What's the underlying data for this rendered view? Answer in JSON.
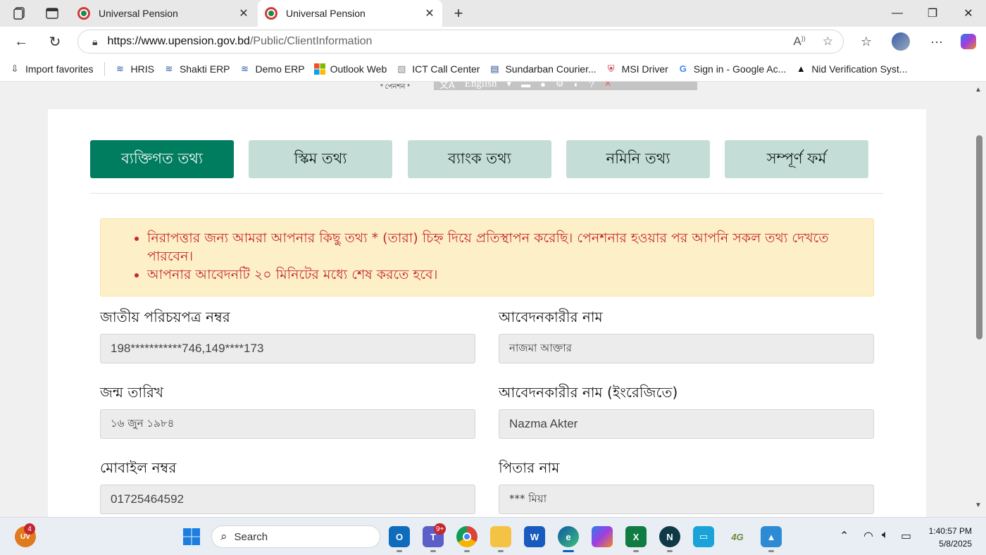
{
  "browser": {
    "tabs": [
      {
        "title": "Universal Pension",
        "active": false
      },
      {
        "title": "Universal Pension",
        "active": true
      }
    ],
    "url_host": "https://www.upension.gov.bd",
    "url_path": "/Public/ClientInformation",
    "favorites": [
      {
        "label": "Import favorites",
        "icon": "import-icon"
      },
      {
        "label": "HRIS",
        "icon": "hris-icon"
      },
      {
        "label": "Shakti ERP",
        "icon": "erp-icon"
      },
      {
        "label": "Demo ERP",
        "icon": "erp-icon"
      },
      {
        "label": "Outlook Web",
        "icon": "microsoft-icon"
      },
      {
        "label": "ICT Call Center",
        "icon": "ict-icon"
      },
      {
        "label": "Sundarban Courier...",
        "icon": "courier-icon"
      },
      {
        "label": "MSI Driver",
        "icon": "msi-icon"
      },
      {
        "label": "Sign in - Google Ac...",
        "icon": "google-icon"
      },
      {
        "label": "Nid Verification Syst...",
        "icon": "angular-icon"
      }
    ]
  },
  "page": {
    "logo_tail": "* পেনশন *",
    "translate_lang": "English",
    "steps": [
      {
        "label": "ব্যক্তিগত তথ্য",
        "active": true
      },
      {
        "label": "স্কিম তথ্য",
        "active": false
      },
      {
        "label": "ব্যাংক তথ্য",
        "active": false
      },
      {
        "label": "নমিনি তথ্য",
        "active": false
      },
      {
        "label": "সম্পূর্ণ ফর্ম",
        "active": false
      }
    ],
    "alert": [
      "নিরাপত্তার জন্য আমরা আপনার কিছু তথ্য * (তারা) চিহ্ন দিয়ে প্রতিস্থাপন করেছি। পেনশনার হওয়ার পর আপনি সকল তথ্য দেখতে পারবেন।",
      "আপনার আবেদনটি ২০ মিনিটের মধ্যে শেষ করতে হবে।"
    ],
    "fields": {
      "nid": {
        "label": "জাতীয় পরিচয়পত্র নম্বর",
        "value": "198***********746,149****173"
      },
      "name_bn": {
        "label": "আবেদনকারীর নাম",
        "value": "নাজমা আক্তার"
      },
      "dob": {
        "label": "জন্ম তারিখ",
        "value": "১৬ জুন ১৯৮৪"
      },
      "name_en": {
        "label": "আবেদনকারীর নাম (ইংরেজিতে)",
        "value": "Nazma Akter"
      },
      "mobile": {
        "label": "মোবাইল নম্বর",
        "value": "01725464592"
      },
      "father": {
        "label": "পিতার নাম",
        "value": "*** মিয়া"
      }
    }
  },
  "taskbar": {
    "search_placeholder": "Search",
    "user_initials": "UV",
    "user_badge": "4",
    "teams_badge": "9+",
    "time": "1:40:57 PM",
    "date": "5/8/2025"
  }
}
